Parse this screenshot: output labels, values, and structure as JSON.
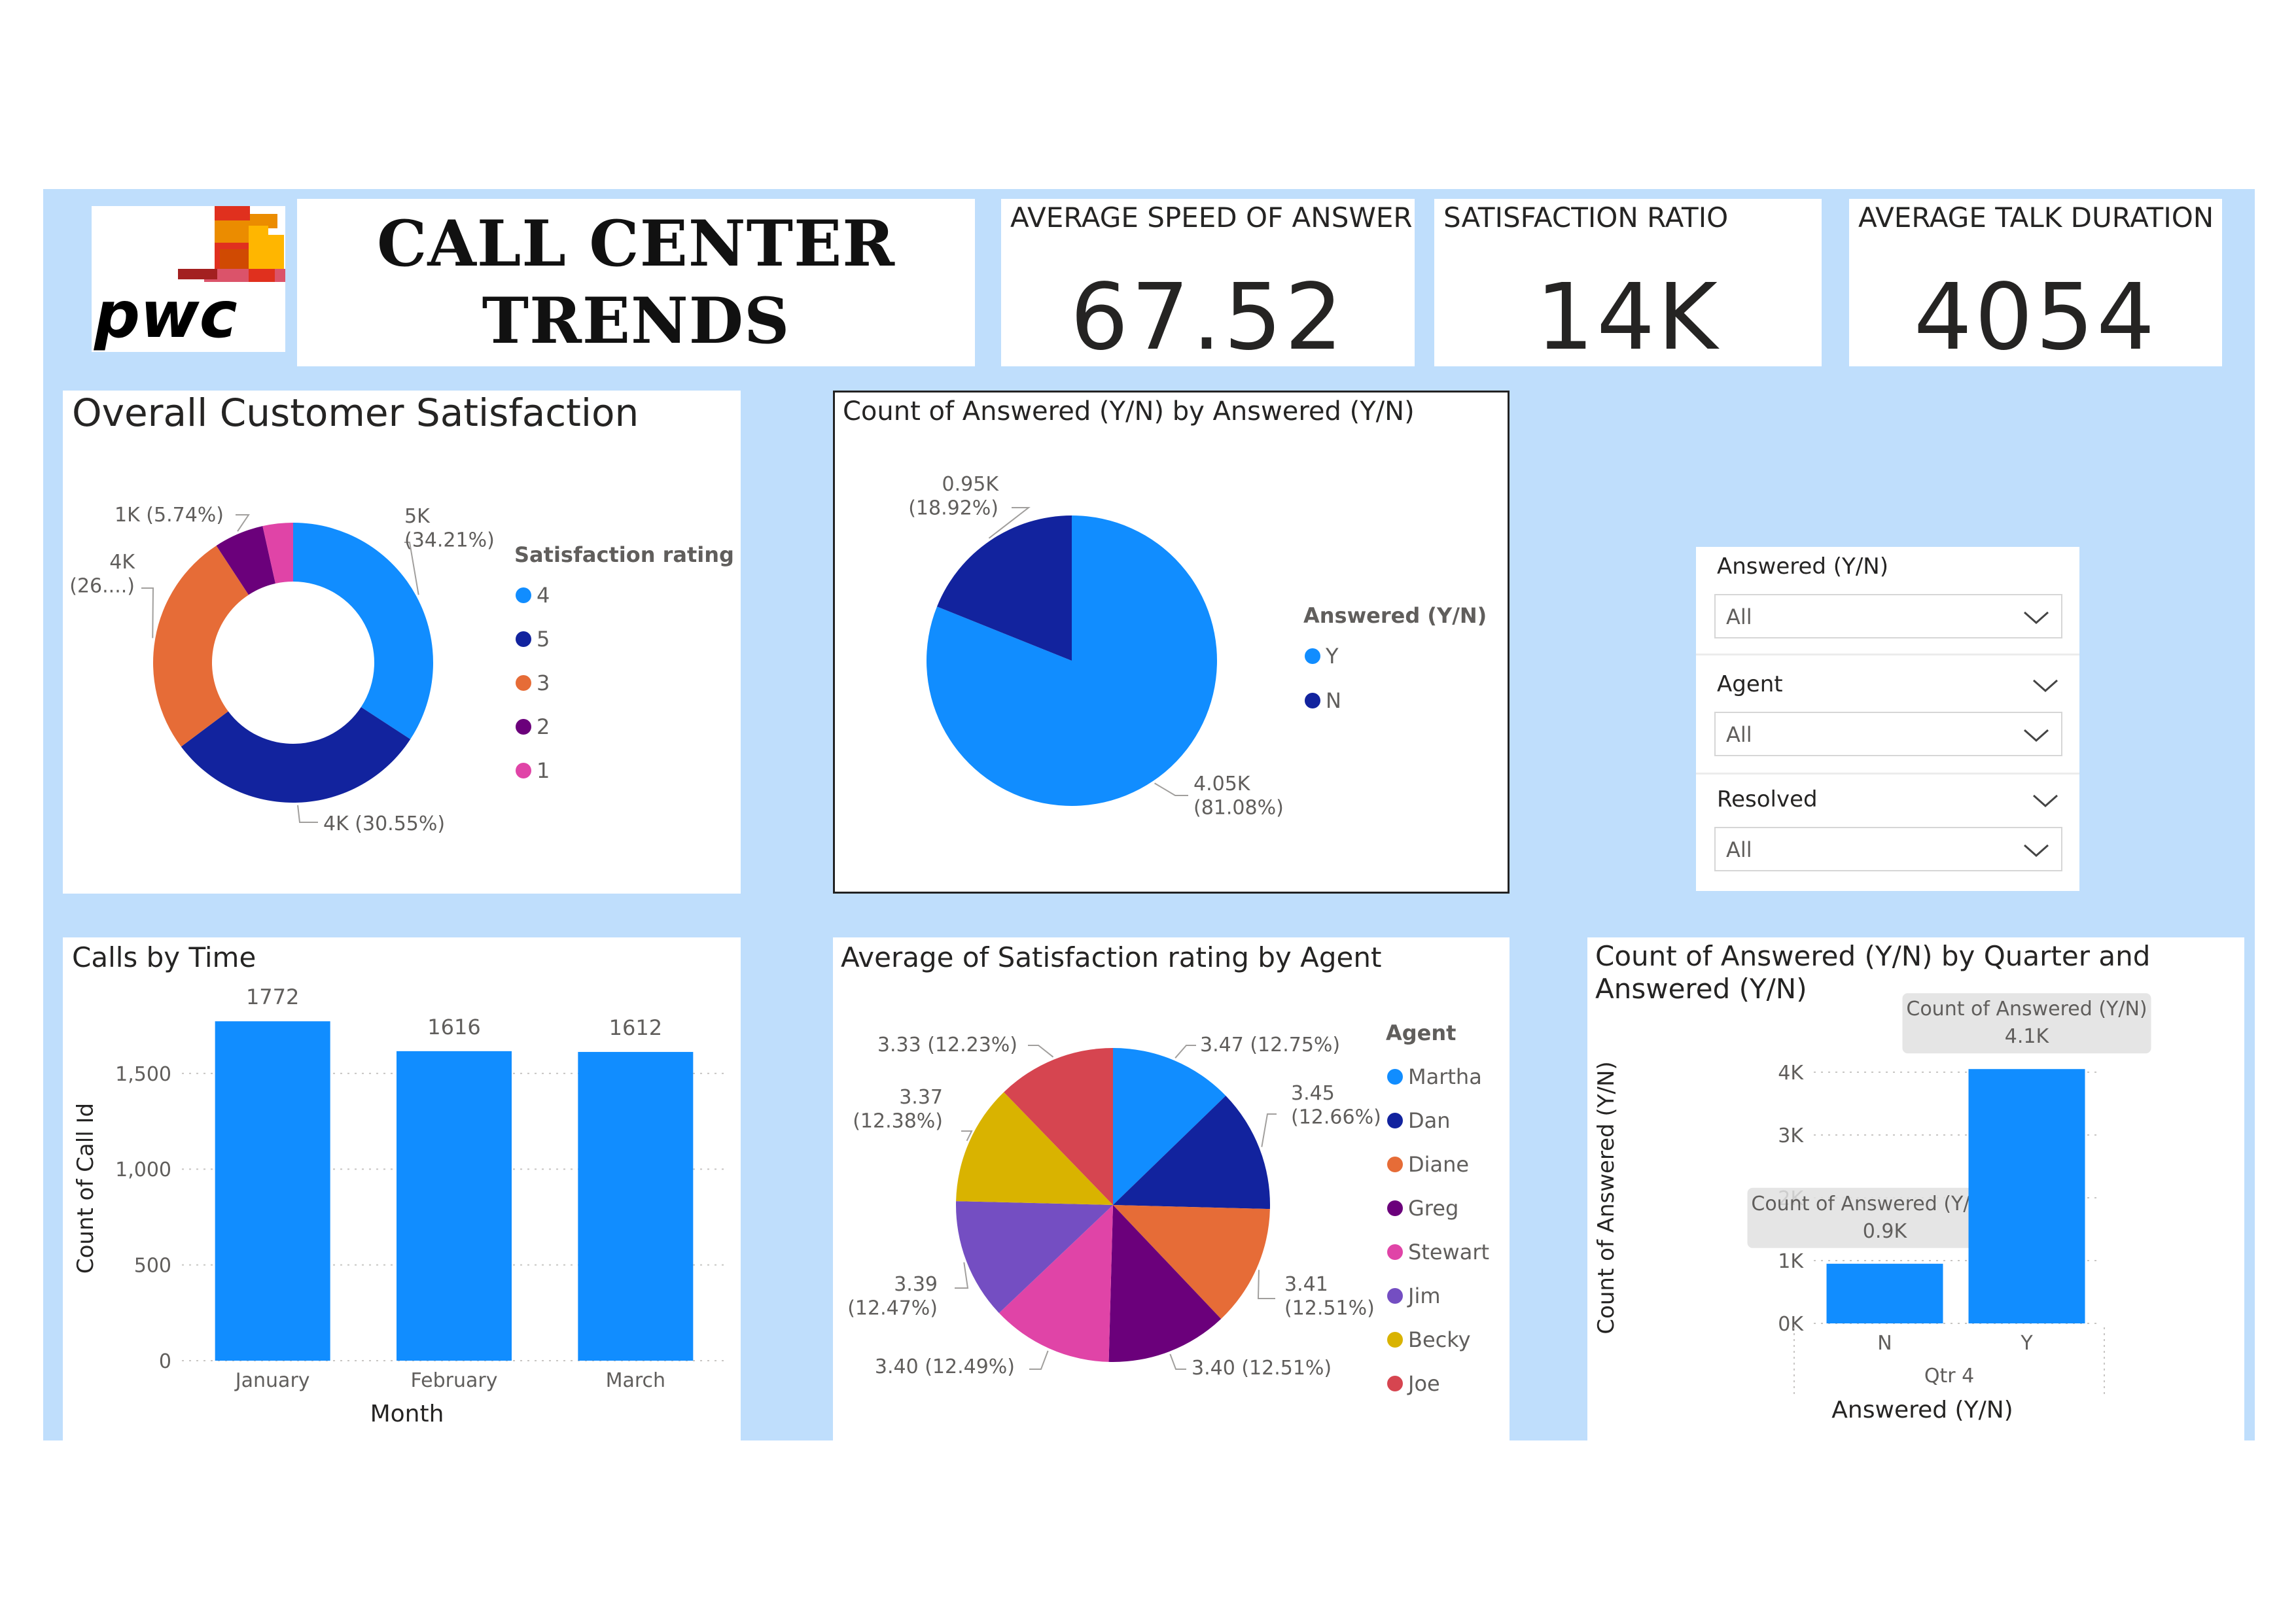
{
  "header": {
    "logo_text": "pwc",
    "title_line1": "CALL CENTER",
    "title_line2": "TRENDS"
  },
  "kpis": [
    {
      "label": "AVERAGE SPEED OF ANSWER",
      "value": "67.52"
    },
    {
      "label": "SATISFACTION RATIO",
      "value": "14K"
    },
    {
      "label": "AVERAGE TALK DURATION",
      "value": "4054"
    }
  ],
  "colors": {
    "dashboard_bg": "#bfdefc",
    "blue": "#118dff",
    "navy": "#12239e",
    "orange": "#e66c37",
    "purple": "#6b007b",
    "pink": "#e044a7",
    "violet": "#744ec2",
    "gold": "#d9b300",
    "red": "#d64550"
  },
  "slicers": [
    {
      "label": "Answered (Y/N)",
      "value": "All"
    },
    {
      "label": "Agent",
      "value": "All"
    },
    {
      "label": "Resolved",
      "value": "All"
    }
  ],
  "chart_data": [
    {
      "type": "pie",
      "variant": "donut",
      "title": "Overall Customer Satisfaction",
      "legend_title": "Satisfaction rating",
      "legend_placement": "right",
      "categories": [
        "4",
        "5",
        "3",
        "2",
        "1"
      ],
      "values": [
        34.21,
        30.55,
        26.0,
        5.74,
        3.5
      ],
      "data_labels": [
        "5K\n(34.21%)",
        "4K (30.55%)",
        "4K\n(26....)",
        "1K (5.74%)",
        ""
      ],
      "colors": [
        "#118dff",
        "#12239e",
        "#e66c37",
        "#6b007b",
        "#e044a7"
      ]
    },
    {
      "type": "pie",
      "title": "Count of Answered (Y/N) by Answered (Y/N)",
      "legend_title": "Answered (Y/N)",
      "legend_placement": "right",
      "categories": [
        "Y",
        "N"
      ],
      "values": [
        81.08,
        18.92
      ],
      "data_labels": [
        "4.05K\n(81.08%)",
        "0.95K\n(18.92%)"
      ],
      "colors": [
        "#118dff",
        "#12239e"
      ]
    },
    {
      "type": "bar",
      "title": "Calls by Time",
      "xlabel": "Month",
      "ylabel": "Count of Call Id",
      "categories": [
        "January",
        "February",
        "March"
      ],
      "values": [
        1772,
        1616,
        1612
      ],
      "yticks": [
        "0",
        "500",
        "1,000",
        "1,500"
      ],
      "ylim": [
        0,
        1800
      ],
      "grid": true,
      "color": "#118dff"
    },
    {
      "type": "pie",
      "title": "Average of Satisfaction rating by Agent",
      "legend_title": "Agent",
      "legend_placement": "right",
      "categories": [
        "Martha",
        "Dan",
        "Diane",
        "Greg",
        "Stewart",
        "Jim",
        "Becky",
        "Joe"
      ],
      "values": [
        12.75,
        12.66,
        12.51,
        12.51,
        12.49,
        12.47,
        12.38,
        12.23
      ],
      "data_labels": [
        "3.47 (12.75%)",
        "3.45\n(12.66%)",
        "3.41\n(12.51%)",
        "3.40 (12.51%)",
        "3.40 (12.49%)",
        "3.39\n(12.47%)",
        "3.37\n(12.38%)",
        "3.33 (12.23%)"
      ],
      "colors": [
        "#118dff",
        "#12239e",
        "#e66c37",
        "#6b007b",
        "#e044a7",
        "#744ec2",
        "#d9b300",
        "#d64550"
      ]
    },
    {
      "type": "bar",
      "title": "Count of Answered (Y/N) by Quarter and\nAnswered (Y/N)",
      "xlabel": "Answered (Y/N)",
      "ylabel": "Count of Answered (Y/N)",
      "group_label": "Qtr 4",
      "categories": [
        "N",
        "Y"
      ],
      "values": [
        950,
        4050
      ],
      "data_labels": [
        "0.9K",
        "4.1K"
      ],
      "tooltip_label": "Count of Answered (Y/N)",
      "yticks": [
        "0K",
        "1K",
        "2K",
        "3K",
        "4K"
      ],
      "ylim": [
        0,
        4000
      ],
      "grid": true,
      "color": "#118dff"
    }
  ]
}
